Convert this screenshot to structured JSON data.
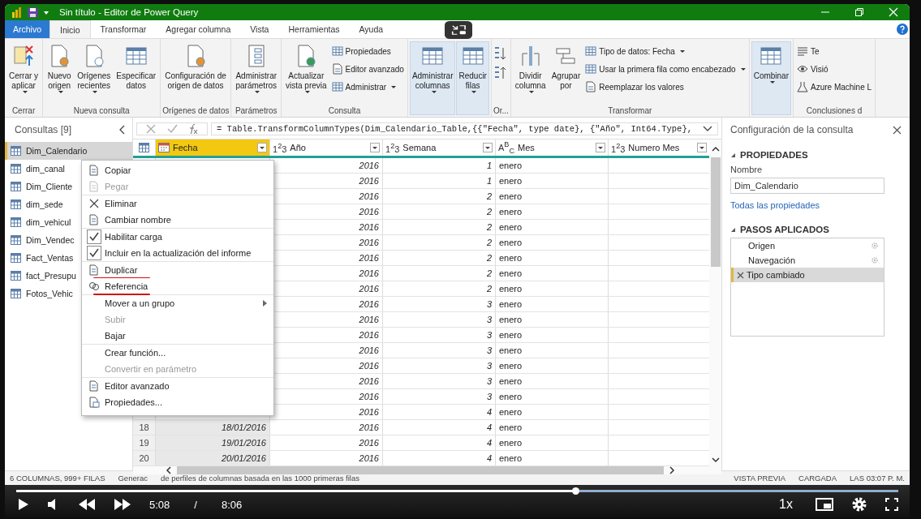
{
  "window": {
    "title": "Sin título - Editor de Power Query"
  },
  "tabs": [
    {
      "label": "Archivo",
      "kind": "file",
      "selected": false
    },
    {
      "label": "Inicio",
      "kind": "tab",
      "selected": true
    },
    {
      "label": "Transformar",
      "kind": "tab",
      "selected": false
    },
    {
      "label": "Agregar columna",
      "kind": "tab",
      "selected": false
    },
    {
      "label": "Vista",
      "kind": "tab",
      "selected": false
    },
    {
      "label": "Herramientas",
      "kind": "tab",
      "selected": false
    },
    {
      "label": "Ayuda",
      "kind": "tab",
      "selected": false
    }
  ],
  "ribbon": [
    {
      "label": "Cerrar",
      "items": [
        {
          "kind": "large",
          "lines": [
            "Cerrar y",
            "aplicar"
          ],
          "dropdown": true,
          "highlighted": false
        }
      ]
    },
    {
      "label": "Nueva consulta",
      "items": [
        {
          "kind": "large",
          "lines": [
            "Nuevo",
            "origen"
          ],
          "dropdown": true,
          "highlighted": false
        },
        {
          "kind": "large",
          "lines": [
            "Orígenes",
            "recientes"
          ],
          "dropdown": true,
          "highlighted": false
        },
        {
          "kind": "large",
          "lines": [
            "Especificar",
            "datos"
          ],
          "dropdown": false,
          "highlighted": false
        }
      ]
    },
    {
      "label": "Orígenes de datos",
      "items": [
        {
          "kind": "large",
          "lines": [
            "Configuración de",
            "origen de datos"
          ],
          "dropdown": false,
          "highlighted": false
        }
      ]
    },
    {
      "label": "Parámetros",
      "items": [
        {
          "kind": "large",
          "lines": [
            "Administrar",
            "parámetros"
          ],
          "dropdown": true,
          "highlighted": false
        }
      ]
    },
    {
      "label": "Consulta",
      "items": [
        {
          "kind": "large",
          "lines": [
            "Actualizar",
            "vista previa"
          ],
          "dropdown": true,
          "highlighted": false
        },
        {
          "kind": "stack",
          "rows": [
            {
              "label": "Propiedades",
              "dropdown": false
            },
            {
              "label": "Editor avanzado",
              "dropdown": false
            },
            {
              "label": "Administrar",
              "dropdown": true
            }
          ]
        }
      ]
    },
    {
      "items": [
        {
          "kind": "large",
          "lines": [
            "Administrar",
            "columnas"
          ],
          "dropdown": true,
          "highlighted": true
        },
        {
          "kind": "large",
          "lines": [
            "Reducir",
            "filas"
          ],
          "dropdown": true,
          "highlighted": true
        }
      ]
    },
    {
      "label": "Or...",
      "items": [
        {
          "kind": "sort"
        }
      ]
    },
    {
      "label": "Transformar",
      "items": [
        {
          "kind": "large",
          "lines": [
            "Dividir",
            "columna"
          ],
          "dropdown": true,
          "highlighted": false
        },
        {
          "kind": "large",
          "lines": [
            "Agrupar",
            "por"
          ],
          "dropdown": false,
          "highlighted": false
        },
        {
          "kind": "stack",
          "rows": [
            {
              "label": "Tipo de datos: Fecha",
              "dropdown": true
            },
            {
              "label": "Usar la primera fila como encabezado",
              "dropdown": true
            },
            {
              "label": "Reemplazar los valores",
              "dropdown": false
            }
          ]
        }
      ]
    },
    {
      "items": [
        {
          "kind": "large",
          "lines": [
            "Combinar"
          ],
          "dropdown": true,
          "highlighted": true
        }
      ]
    },
    {
      "label": "Conclusiones d",
      "items": [
        {
          "kind": "stack",
          "rows": [
            {
              "label": "Te",
              "dropdown": false
            },
            {
              "label": "Visió",
              "dropdown": false
            },
            {
              "label": "Azure Machine L",
              "dropdown": false
            }
          ]
        }
      ]
    }
  ],
  "queries": {
    "title": "Consultas [9]",
    "items": [
      {
        "label": "Dim_Calendario",
        "selected": true
      },
      {
        "label": "dim_canal",
        "selected": false
      },
      {
        "label": "Dim_Cliente",
        "selected": false
      },
      {
        "label": "dim_sede",
        "selected": false
      },
      {
        "label": "dim_vehicul",
        "selected": false
      },
      {
        "label": "Dim_Vendec",
        "selected": false
      },
      {
        "label": "Fact_Ventas",
        "selected": false
      },
      {
        "label": "fact_Presupu",
        "selected": false
      },
      {
        "label": "Fotos_Vehic",
        "selected": false
      }
    ]
  },
  "context_menu": {
    "sections": [
      [
        {
          "label": "Copiar",
          "kind": "plain",
          "disabled": false,
          "marked": false
        },
        {
          "label": "Pegar",
          "kind": "plain",
          "disabled": true,
          "marked": false
        }
      ],
      [
        {
          "label": "Eliminar",
          "kind": "plain",
          "disabled": false,
          "marked": false
        },
        {
          "label": "Cambiar nombre",
          "kind": "plain",
          "disabled": false,
          "marked": false
        }
      ],
      [
        {
          "label": "Habilitar carga",
          "kind": "check",
          "checked": true,
          "disabled": false,
          "marked": false
        },
        {
          "label": "Incluir en la actualización del informe",
          "kind": "check",
          "checked": true,
          "disabled": false,
          "marked": false
        }
      ],
      [
        {
          "label": "Duplicar",
          "kind": "plain",
          "disabled": false,
          "marked": true
        },
        {
          "label": "Referencia",
          "kind": "plain",
          "disabled": false,
          "marked": true
        }
      ],
      [
        {
          "label": "Mover a un grupo",
          "kind": "submenu",
          "disabled": false,
          "marked": false
        },
        {
          "label": "Subir",
          "kind": "plain",
          "disabled": true,
          "marked": false
        },
        {
          "label": "Bajar",
          "kind": "plain",
          "disabled": false,
          "marked": false
        }
      ],
      [
        {
          "label": "Crear función...",
          "kind": "plain",
          "disabled": false,
          "marked": false
        },
        {
          "label": "Convertir en parámetro",
          "kind": "plain",
          "disabled": true,
          "marked": false
        }
      ],
      [
        {
          "label": "Editor avanzado",
          "kind": "plain",
          "disabled": false,
          "marked": false
        },
        {
          "label": "Propiedades...",
          "kind": "plain",
          "disabled": false,
          "marked": false
        }
      ]
    ]
  },
  "formula": "= Table.TransformColumnTypes(Dim_Calendario_Table,{{\"Fecha\", type date}, {\"Año\", Int64.Type},",
  "table": {
    "columns": [
      {
        "label": "Fecha",
        "kind": "date",
        "selected": true
      },
      {
        "label": "Año",
        "kind": "typed",
        "type_label": "1$^{2}$3",
        "selected": false
      },
      {
        "label": "Semana",
        "kind": "typed",
        "type_label": "1$^{2}$3",
        "selected": false
      },
      {
        "label": "Mes",
        "kind": "typed",
        "type_label": "A$^{B}$$_{C}$",
        "selected": false
      },
      {
        "label": "Numero Mes",
        "kind": "typed",
        "type_label": "1$^{2}$3",
        "selected": false
      }
    ],
    "rows": [
      {
        "ano": "2016",
        "semana": "1",
        "mes": "enero"
      },
      {
        "ano": "2016",
        "semana": "1",
        "mes": "enero"
      },
      {
        "ano": "2016",
        "semana": "2",
        "mes": "enero"
      },
      {
        "ano": "2016",
        "semana": "2",
        "mes": "enero"
      },
      {
        "ano": "2016",
        "semana": "2",
        "mes": "enero"
      },
      {
        "ano": "2016",
        "semana": "2",
        "mes": "enero"
      },
      {
        "ano": "2016",
        "semana": "2",
        "mes": "enero"
      },
      {
        "ano": "2016",
        "semana": "2",
        "mes": "enero"
      },
      {
        "ano": "2016",
        "semana": "2",
        "mes": "enero"
      },
      {
        "ano": "2016",
        "semana": "3",
        "mes": "enero"
      },
      {
        "ano": "2016",
        "semana": "3",
        "mes": "enero"
      },
      {
        "ano": "2016",
        "semana": "3",
        "mes": "enero"
      },
      {
        "ano": "2016",
        "semana": "3",
        "mes": "enero"
      },
      {
        "ano": "2016",
        "semana": "3",
        "mes": "enero"
      },
      {
        "ano": "2016",
        "semana": "3",
        "mes": "enero"
      },
      {
        "ano": "2016",
        "semana": "3",
        "mes": "enero"
      },
      {
        "ano": "2016",
        "semana": "4",
        "mes": "enero"
      },
      {
        "num": "18",
        "fecha": "18/01/2016",
        "ano": "2016",
        "semana": "4",
        "mes": "enero"
      },
      {
        "num": "19",
        "fecha": "19/01/2016",
        "ano": "2016",
        "semana": "4",
        "mes": "enero"
      },
      {
        "num": "20",
        "fecha": "20/01/2016",
        "ano": "2016",
        "semana": "4",
        "mes": "enero"
      }
    ]
  },
  "settings": {
    "title": "Configuración de la consulta",
    "properties_heading": "PROPIEDADES",
    "name_label": "Nombre",
    "name_value": "Dim_Calendario",
    "all_properties": "Todas las propiedades",
    "steps_heading": "PASOS APLICADOS",
    "steps": [
      {
        "label": "Origen",
        "selected": false,
        "has_settings": true
      },
      {
        "label": "Navegación",
        "selected": false,
        "has_settings": true
      },
      {
        "label": "Tipo cambiado",
        "selected": true,
        "has_settings": false
      }
    ]
  },
  "status_bar": {
    "left": [
      "6 COLUMNAS, 999+ FILAS",
      "Generac",
      "de perfiles de columnas basada en las 1000 primeras filas"
    ],
    "right": [
      "VISTA PREVIA",
      "CARGADA",
      "LAS 03:07 P. M."
    ]
  },
  "player": {
    "level": 0.634,
    "current": "5:08",
    "separator": "/",
    "duration": "8:06",
    "speed": "1x"
  }
}
